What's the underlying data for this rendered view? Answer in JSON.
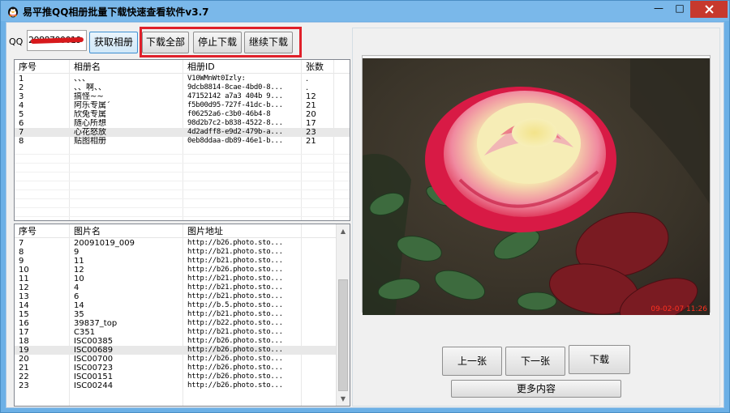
{
  "window": {
    "title": "易平推QQ相册批量下载快速查看软件v3.7",
    "minimize": "—",
    "maximize": "□",
    "close": "✕"
  },
  "toolbar": {
    "qq_label": "QQ",
    "qq_value": "2088700019",
    "fetch_albums": "获取相册",
    "download_all": "下载全部",
    "stop_download": "停止下载",
    "resume_download": "继续下载",
    "highlight_color": "#e0202a"
  },
  "albums": {
    "columns": [
      "序号",
      "相册名",
      "相册ID",
      "张数"
    ],
    "rows": [
      {
        "no": "1",
        "name": "、、、",
        "id": "V10WMnWt0Izly:",
        "count": "."
      },
      {
        "no": "2",
        "name": "、、啊、、",
        "id": "9dcb8814-8cae-4bd0-8...",
        "count": "."
      },
      {
        "no": "3",
        "name": "搞怪~~",
        "id": "47152142 a7a3 404b 9...",
        "count": "12"
      },
      {
        "no": "4",
        "name": "阿乐专属´",
        "id": "f5b00d95-727f-41dc-b...",
        "count": "21"
      },
      {
        "no": "5",
        "name": "欣兔专属",
        "id": "f06252a6-c3b0-46b4-8",
        "count": "20"
      },
      {
        "no": "6",
        "name": "随心所想",
        "id": "98d2b7c2-b838-4522-8...",
        "count": "17"
      },
      {
        "no": "7",
        "name": "心花怒放",
        "id": "4d2adff8-e9d2-479b-a...",
        "count": "23"
      },
      {
        "no": "8",
        "name": "贴图相册",
        "id": "0eb8ddaa-db89-46e1-b...",
        "count": "21"
      }
    ]
  },
  "photos": {
    "columns": [
      "序号",
      "图片名",
      "图片地址"
    ],
    "rows": [
      {
        "no": "7",
        "name": "20091019_009",
        "url": "http://b26.photo.sto..."
      },
      {
        "no": "8",
        "name": "9",
        "url": "http://b21.photo.sto..."
      },
      {
        "no": "9",
        "name": "11",
        "url": "http://b21.photo.sto..."
      },
      {
        "no": "10",
        "name": "12",
        "url": "http://b26.photo.sto..."
      },
      {
        "no": "11",
        "name": "10",
        "url": "http://b21.photo.sto..."
      },
      {
        "no": "12",
        "name": "4",
        "url": "http://b21.photo.sto..."
      },
      {
        "no": "13",
        "name": "6",
        "url": "http://b21.photo.sto..."
      },
      {
        "no": "14",
        "name": "14",
        "url": "http://b.5.photo.sto..."
      },
      {
        "no": "15",
        "name": "35",
        "url": "http://b21.photo.sto..."
      },
      {
        "no": "16",
        "name": "39837_top",
        "url": "http://b22.photo.sto..."
      },
      {
        "no": "17",
        "name": "C351",
        "url": "http://b21.photo.sto..."
      },
      {
        "no": "18",
        "name": "ISC00385",
        "url": "http://b26.photo.sto..."
      },
      {
        "no": "19",
        "name": "ISC00689",
        "url": "http://b26.photo.sto..."
      },
      {
        "no": "20",
        "name": "ISC00700",
        "url": "http://b26.photo.sto..."
      },
      {
        "no": "21",
        "name": "ISC00723",
        "url": "http://b26.photo.sto..."
      },
      {
        "no": "22",
        "name": "ISC00151",
        "url": "http://b26.photo.sto..."
      },
      {
        "no": "23",
        "name": "ISC00244",
        "url": "http://b26.photo.sto..."
      }
    ]
  },
  "preview": {
    "timestamp": "09-02-07 11:26",
    "prev": "上一张",
    "next": "下一张",
    "download": "下载",
    "more": "更多内容"
  }
}
